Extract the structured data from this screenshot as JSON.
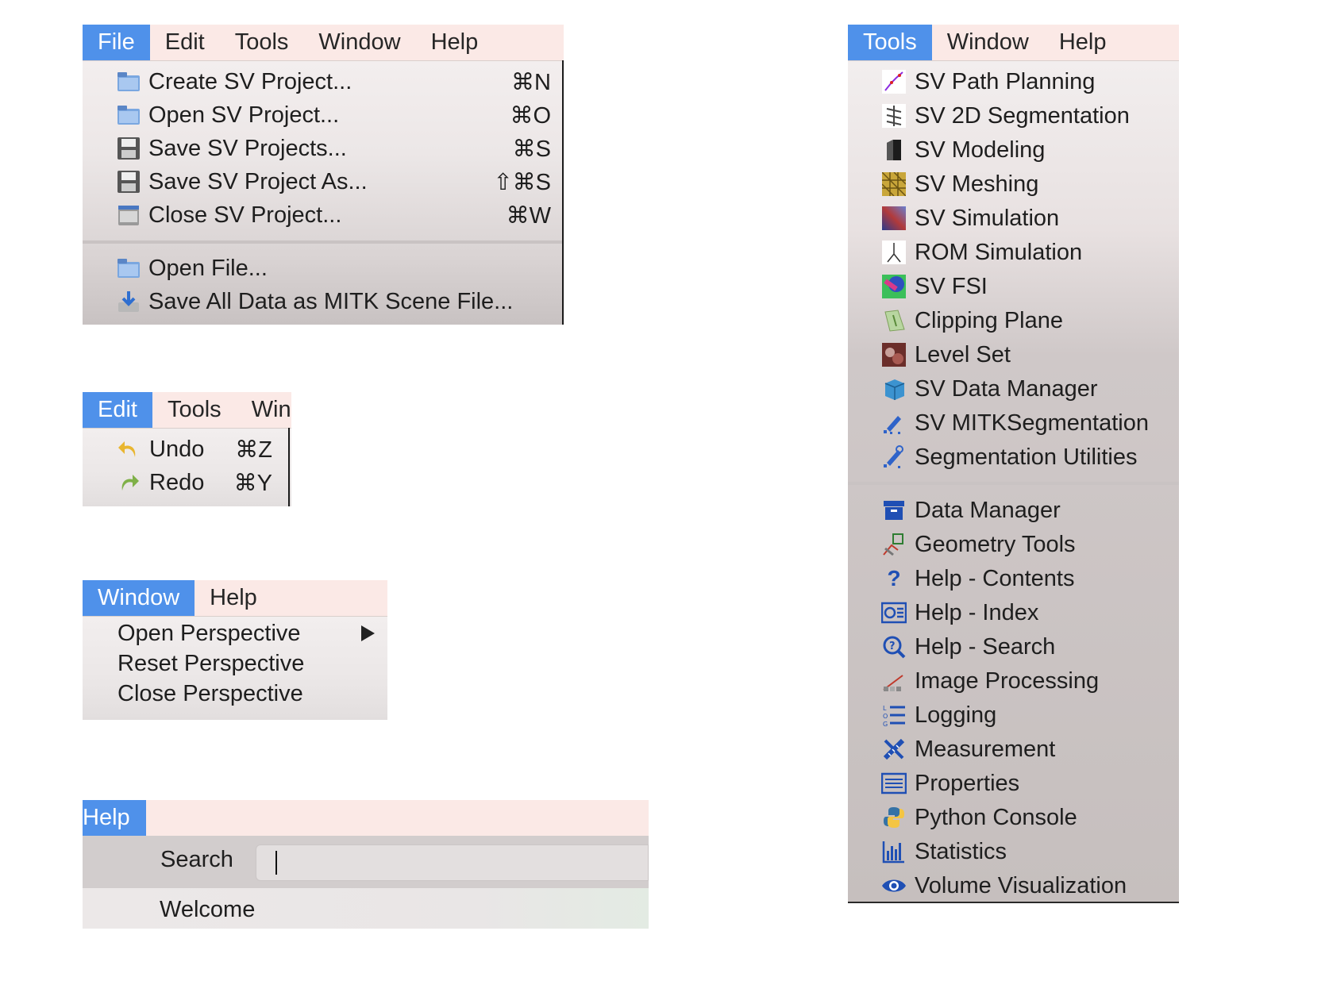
{
  "file_panel": {
    "menubar": [
      "File",
      "Edit",
      "Tools",
      "Window",
      "Help"
    ],
    "items": [
      {
        "label": "Create SV Project...",
        "shortcut": "⌘N",
        "icon": "folder-icon"
      },
      {
        "label": "Open SV Project...",
        "shortcut": "⌘O",
        "icon": "folder-icon"
      },
      {
        "label": "Save SV Projects...",
        "shortcut": "⌘S",
        "icon": "floppy-icon"
      },
      {
        "label": "Save SV Project As...",
        "shortcut": "⇧⌘S",
        "icon": "floppy-icon"
      },
      {
        "label": "Close SV Project...",
        "shortcut": "⌘W",
        "icon": "drawer-icon"
      },
      {
        "label": "Open File...",
        "shortcut": "",
        "icon": "folder-icon"
      },
      {
        "label": "Save All Data as MITK Scene File...",
        "shortcut": "",
        "icon": "save-scene-icon"
      }
    ]
  },
  "edit_panel": {
    "menubar": [
      "Edit",
      "Tools",
      "Win"
    ],
    "items": [
      {
        "label": "Undo",
        "shortcut": "⌘Z",
        "icon": "undo-arrow-icon"
      },
      {
        "label": "Redo",
        "shortcut": "⌘Y",
        "icon": "redo-arrow-icon"
      }
    ]
  },
  "window_panel": {
    "menubar": [
      "Window",
      "Help"
    ],
    "items": [
      {
        "label": "Open Perspective",
        "submenu": true
      },
      {
        "label": "Reset Perspective",
        "submenu": false
      },
      {
        "label": "Close Perspective",
        "submenu": false
      }
    ]
  },
  "help_panel": {
    "menubar": [
      "Help"
    ],
    "search_label": "Search",
    "search_value": "",
    "items": [
      {
        "label": "Welcome"
      }
    ]
  },
  "tools_panel": {
    "menubar": [
      "Tools",
      "Window",
      "Help"
    ],
    "items_group1": [
      {
        "label": "SV Path Planning",
        "icon": "path-planning-icon"
      },
      {
        "label": "SV 2D Segmentation",
        "icon": "segmentation-2d-icon"
      },
      {
        "label": "SV Modeling",
        "icon": "modeling-icon"
      },
      {
        "label": "SV Meshing",
        "icon": "meshing-icon"
      },
      {
        "label": "SV Simulation",
        "icon": "simulation-icon"
      },
      {
        "label": "ROM Simulation",
        "icon": "rom-simulation-icon"
      },
      {
        "label": "SV FSI",
        "icon": "fsi-icon"
      },
      {
        "label": "Clipping Plane",
        "icon": "clipping-plane-icon"
      },
      {
        "label": "Level Set",
        "icon": "level-set-icon"
      },
      {
        "label": "SV Data Manager",
        "icon": "data-manager-cube-icon"
      },
      {
        "label": "SV MITKSegmentation",
        "icon": "mitk-segmentation-icon"
      },
      {
        "label": "Segmentation Utilities",
        "icon": "segmentation-utilities-icon"
      }
    ],
    "items_group2": [
      {
        "label": "Data Manager",
        "icon": "archive-box-icon"
      },
      {
        "label": "Geometry Tools",
        "icon": "geometry-tools-icon"
      },
      {
        "label": "Help - Contents",
        "icon": "question-mark-icon"
      },
      {
        "label": "Help - Index",
        "icon": "help-index-icon"
      },
      {
        "label": "Help - Search",
        "icon": "help-search-icon"
      },
      {
        "label": "Image Processing",
        "icon": "image-processing-icon"
      },
      {
        "label": "Logging",
        "icon": "logging-list-icon"
      },
      {
        "label": "Measurement",
        "icon": "measurement-icon"
      },
      {
        "label": "Properties",
        "icon": "properties-list-icon"
      },
      {
        "label": "Python Console",
        "icon": "python-icon"
      },
      {
        "label": "Statistics",
        "icon": "bar-chart-icon"
      },
      {
        "label": "Volume Visualization",
        "icon": "eye-icon"
      }
    ]
  },
  "colors": {
    "accent": "#4f91ea",
    "menubar_bg": "#fbe9e6"
  }
}
